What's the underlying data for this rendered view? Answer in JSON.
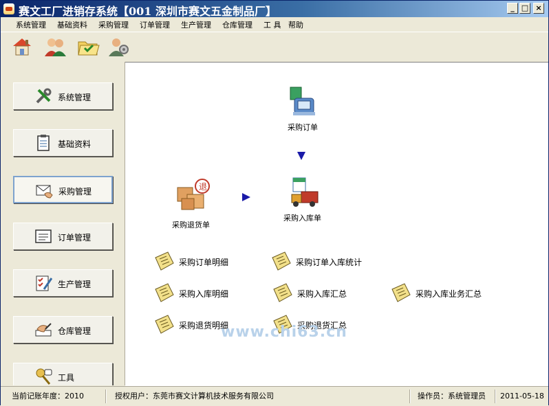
{
  "window": {
    "title": "赛文工厂进销存系统【001 深圳市赛文五金制品厂】",
    "minimize": "_",
    "maximize": "□",
    "close": "×"
  },
  "menu": [
    "系统管理",
    "基础资料",
    "采购管理",
    "订单管理",
    "生产管理",
    "仓库管理",
    "工 具",
    "帮助"
  ],
  "toolbar": [
    "home-icon",
    "users-icon",
    "folder-icon",
    "user-settings-icon"
  ],
  "nav": [
    {
      "label": "系统管理",
      "icon": "tools-icon"
    },
    {
      "label": "基础资料",
      "icon": "clipboard-icon"
    },
    {
      "label": "采购管理",
      "icon": "mail-hand-icon"
    },
    {
      "label": "订单管理",
      "icon": "document-icon"
    },
    {
      "label": "生产管理",
      "icon": "checklist-icon"
    },
    {
      "label": "仓库管理",
      "icon": "writing-hand-icon"
    },
    {
      "label": "工具",
      "icon": "key-icon"
    }
  ],
  "flow": {
    "order": "采购订单",
    "inbound": "采购入库单",
    "return": "采购退货单"
  },
  "reports": [
    "采购订单明细",
    "采购订单入库统计",
    "采购入库明细",
    "采购入库汇总",
    "采购入库业务汇总",
    "采购退货明细",
    "采购退货汇总"
  ],
  "watermark": "www.chi63.cn",
  "status": {
    "year": "当前记账年度：2010",
    "user": "授权用户：东莞市赛文计算机技术服务有限公司",
    "operator": "操作员：系统管理员",
    "date": "2011-05-18"
  },
  "colors": {
    "accent": "#0a246a",
    "arrow": "#1a1aa8"
  }
}
